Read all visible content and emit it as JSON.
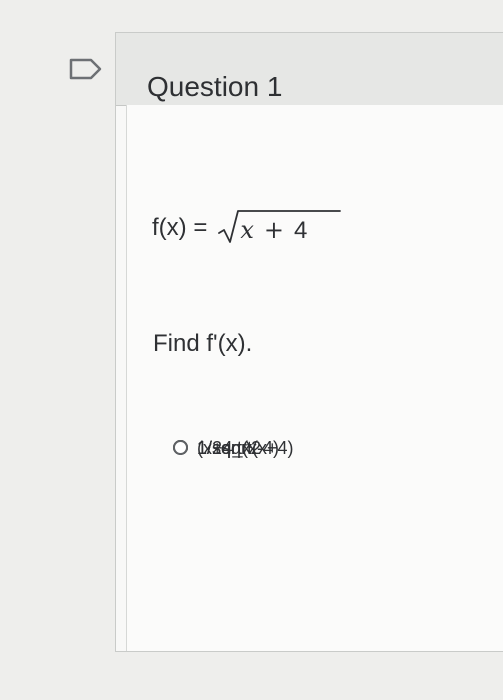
{
  "question": {
    "title": "Question 1",
    "formula_lhs": "f(x) =",
    "radicand_var": "x",
    "radicand_op": "+",
    "radicand_const": "4",
    "prompt": "Find f'(x).",
    "options": [
      {
        "label": "(x+4_^2",
        "selected": false
      },
      {
        "label": "1/sqrtx",
        "selected": false
      },
      {
        "label": "1/2sqrt(x+4)",
        "selected": false
      },
      {
        "label": "1/sqrt(x-4)",
        "selected": false
      }
    ]
  },
  "icons": {
    "bookmark": "bookmark-flag-icon",
    "radio": "radio-unselected-icon"
  },
  "colors": {
    "page_background": "#eeeeec",
    "card_background": "#f8f8f7",
    "header_background": "#e6e7e5",
    "border": "#c9cbc9",
    "text": "#2d3033",
    "radio_border": "#5f6265"
  }
}
